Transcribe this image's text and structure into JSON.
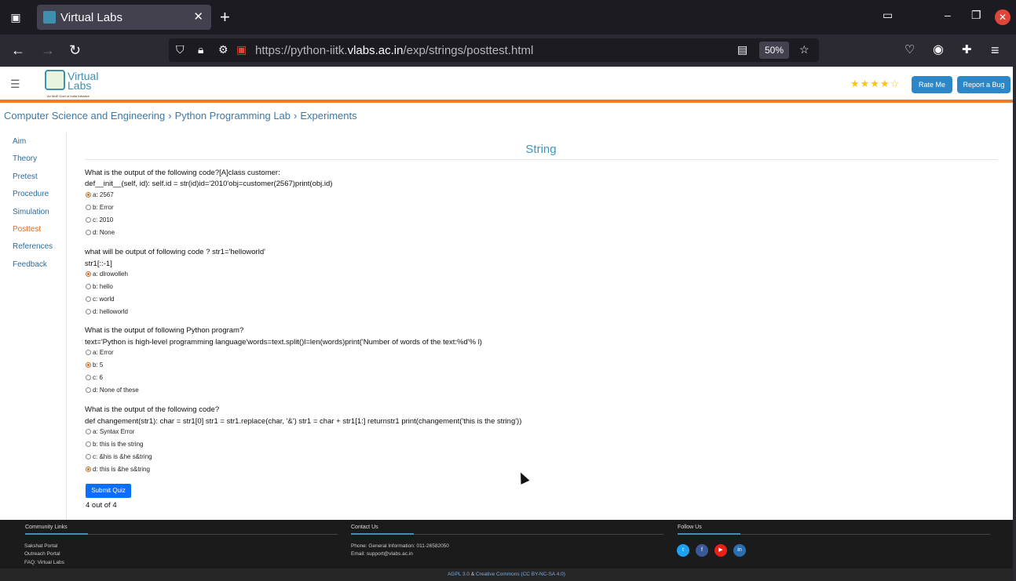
{
  "browser": {
    "tab_title": "Virtual Labs",
    "url_prefix": "https://python-iitk.",
    "url_host": "vlabs.ac.in",
    "url_path": "/exp/strings/posttest.html",
    "zoom": "50%"
  },
  "header": {
    "logo_text_1": "Virtual",
    "logo_text_2": "Labs",
    "logo_tagline": "An MoE Govt of India Initiative",
    "rating_stars": "★★★★☆",
    "rate_me": "Rate Me",
    "report_bug": "Report a Bug"
  },
  "breadcrumb": [
    "Computer Science and Engineering",
    "Python Programming Lab",
    "Experiments"
  ],
  "sidebar": [
    {
      "label": "Aim"
    },
    {
      "label": "Theory"
    },
    {
      "label": "Pretest"
    },
    {
      "label": "Procedure"
    },
    {
      "label": "Simulation"
    },
    {
      "label": "Posttest",
      "active": true
    },
    {
      "label": "References"
    },
    {
      "label": "Feedback"
    }
  ],
  "main": {
    "title": "String",
    "questions": [
      {
        "line1": "What is the output of the following code?[A]class customer:",
        "line2": "def__init__(self, id): self.id = str(id)id='2010'obj=customer(2567)print(obj.id)",
        "options": [
          {
            "text": "a: 2567",
            "selected": true
          },
          {
            "text": "b: Error",
            "selected": false
          },
          {
            "text": "c: 2010",
            "selected": false
          },
          {
            "text": "d: None",
            "selected": false
          }
        ]
      },
      {
        "line1": "what will be output of following code ? str1='helloworld'",
        "line2": "str1[::-1]",
        "options": [
          {
            "text": "a: dlrowolleh",
            "selected": true
          },
          {
            "text": "b: hello",
            "selected": false
          },
          {
            "text": "c: world",
            "selected": false
          },
          {
            "text": "d: helloworld",
            "selected": false
          }
        ]
      },
      {
        "line1": "What is the output of following Python program?",
        "line2": "text='Python is high-level programming language'words=text.split()l=len(words)print('Number of words of the text:%d'% l)",
        "options": [
          {
            "text": "a: Error",
            "selected": false
          },
          {
            "text": "b: 5",
            "selected": true
          },
          {
            "text": "c: 6",
            "selected": false
          },
          {
            "text": "d: None of these",
            "selected": false
          }
        ]
      },
      {
        "line1": "What is the output of the following code?",
        "line2": "def changement(str1): char = str1[0] str1 = str1.replace(char, '&') str1 = char + str1[1:] returnstr1 print(changement('this is the string'))",
        "options": [
          {
            "text": "a: Syntax Error",
            "selected": false
          },
          {
            "text": "b: this is the string",
            "selected": false
          },
          {
            "text": "c: &his is &he s&tring",
            "selected": false
          },
          {
            "text": "d: this is &he s&tring",
            "selected": true
          }
        ]
      }
    ],
    "submit_label": "Submit Quiz",
    "score": "4 out of 4"
  },
  "footer": {
    "community_title": "Community Links",
    "community_links": [
      "Sakshat Portal",
      "Outreach Portal",
      "FAQ: Virtual Labs"
    ],
    "contact_title": "Contact Us",
    "contact_phone": "Phone: General Information: 011-26582050",
    "contact_email": "Email: support@vlabs.ac.in",
    "follow_title": "Follow Us",
    "social_icons": [
      "twitter-icon",
      "facebook-icon",
      "youtube-icon",
      "linkedin-icon"
    ],
    "license_1": "AGPL 3.0",
    "license_sep": "&",
    "license_2": "Creative Commons (CC BY-NC-SA 4.0)"
  },
  "colors": {
    "accent_orange": "#f07b26",
    "link_blue": "#3e79a6",
    "button_blue": "#2b87c8"
  }
}
